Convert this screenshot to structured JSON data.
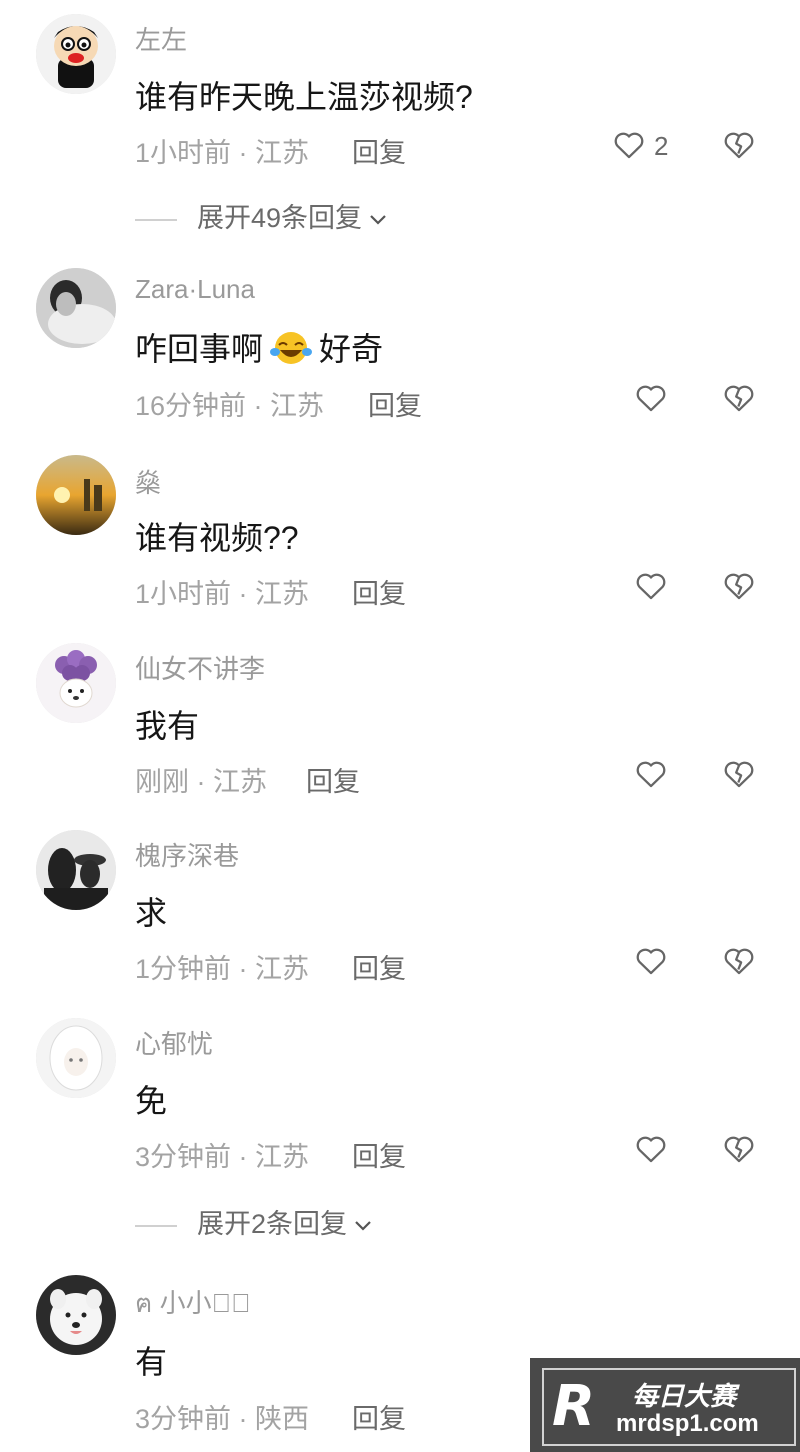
{
  "comments": [
    {
      "username": "左左",
      "text": "谁有昨天晚上温莎视频?",
      "time": "1小时前 · 江苏",
      "reply": "回复",
      "likes": "2",
      "expand": "展开49条回复"
    },
    {
      "username": "Zara·Luna",
      "text_before": "咋回事啊",
      "text_after": "好奇",
      "time": "16分钟前 · 江苏",
      "reply": "回复"
    },
    {
      "username": "燊",
      "text": "谁有视频??",
      "time": "1小时前 · 江苏",
      "reply": "回复"
    },
    {
      "username": "仙女不讲李",
      "text": "我有",
      "time": "刚刚 · 江苏",
      "reply": "回复"
    },
    {
      "username": "槐序深巷",
      "text": "求",
      "time": "1分钟前 · 江苏",
      "reply": "回复"
    },
    {
      "username": "心郁忧",
      "text": "免",
      "time": "3分钟前 · 江苏",
      "reply": "回复",
      "expand": "展开2条回复"
    },
    {
      "username": "ฅ 小小ง゙",
      "text": "有",
      "time": "3分钟前 · 陕西",
      "reply": "回复"
    }
  ],
  "icons": {
    "like": "heart-outline-icon",
    "dislike": "broken-heart-icon",
    "expand": "chevron-down-icon",
    "emoji": "laughing-tears-emoji"
  },
  "watermark": {
    "logo": "R",
    "title": "每日大赛",
    "url": "mrdsp1.com"
  }
}
